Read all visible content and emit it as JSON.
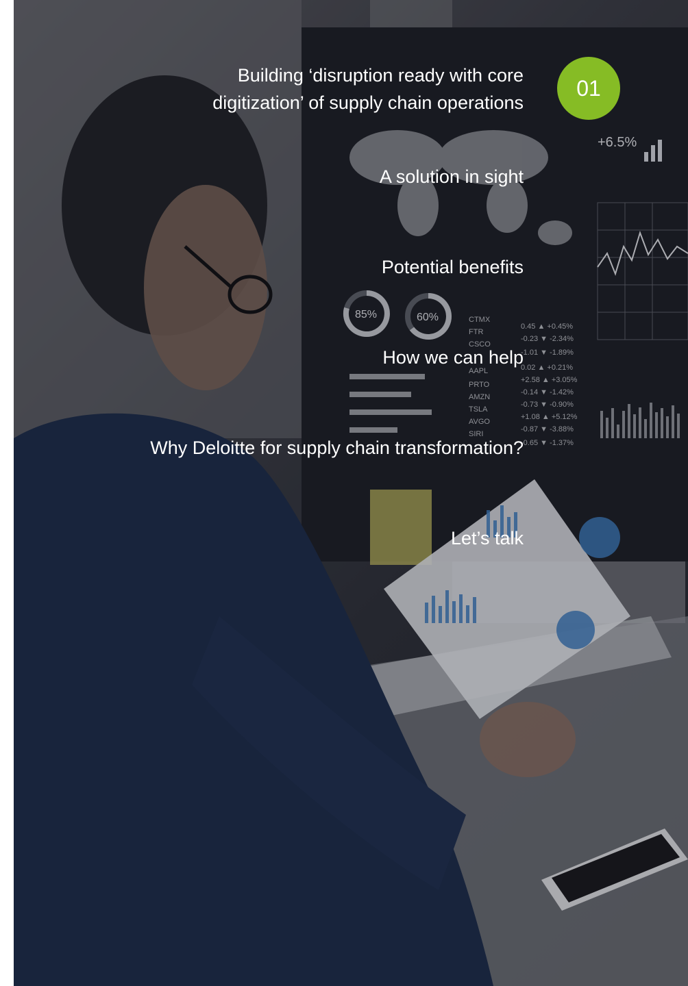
{
  "badge": {
    "number": "01",
    "color": "#86bc25"
  },
  "toc": {
    "items": [
      {
        "label": "Building ‘disruption ready with core"
      },
      {
        "label": "digitization’ of supply chain operations"
      },
      {
        "label": "A solution in sight"
      },
      {
        "label": "Potential benefits"
      },
      {
        "label": "How we can help"
      },
      {
        "label": "Why Deloitte for supply chain transformation?"
      },
      {
        "label": "Let’s talk"
      }
    ]
  },
  "background_photo": {
    "description_icon": "photo-man-analyzing-data",
    "dashboard": {
      "donuts": [
        "85%",
        "60%"
      ],
      "headline_stat": "+6.5%",
      "tickers": [
        {
          "symbol": "CTMX",
          "value": "0.45",
          "change": "+0.45%"
        },
        {
          "symbol": "FTR",
          "value": "-0.23",
          "change": "-2.34%"
        },
        {
          "symbol": "CSCO",
          "value": "-1.01",
          "change": "-1.89%"
        },
        {
          "symbol": "AAPL",
          "value": "0.02",
          "change": "+0.21%"
        },
        {
          "symbol": "PRTO",
          "value": "+2.58",
          "change": "+3.05%"
        },
        {
          "symbol": "AMZN",
          "value": "-0.14",
          "change": "-1.42%"
        },
        {
          "symbol": "TSLA",
          "value": "-0.73",
          "change": "-0.90%"
        },
        {
          "symbol": "AVGO",
          "value": "+1.08",
          "change": "+5.12%"
        },
        {
          "symbol": "SIRI",
          "value": "-0.87",
          "change": "-3.88%"
        },
        {
          "symbol": "",
          "value": "-0.65",
          "change": "-1.37%"
        }
      ]
    }
  }
}
